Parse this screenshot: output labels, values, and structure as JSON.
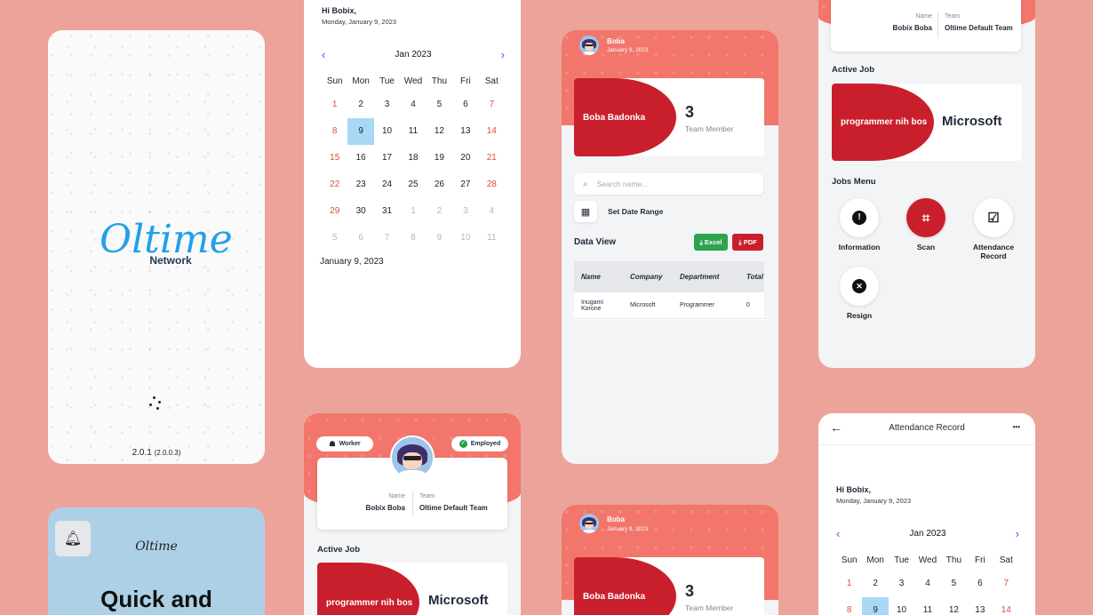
{
  "splash": {
    "brand": "Oltime",
    "sub": "Network",
    "version": "2.0.1",
    "build": "(2.0.0.3)"
  },
  "onboard": {
    "brand": "Oltime",
    "headline": "Quick and"
  },
  "calendar1": {
    "greeting": "Hi Bobix,",
    "date": "Monday, January 9, 2023",
    "month": "Jan 2023",
    "prev": "‹",
    "next": "›",
    "weekdays": [
      "Sun",
      "Mon",
      "Tue",
      "Wed",
      "Thu",
      "Fri",
      "Sat"
    ],
    "days": [
      "1",
      "2",
      "3",
      "4",
      "5",
      "6",
      "7",
      "8",
      "9",
      "10",
      "11",
      "12",
      "13",
      "14",
      "15",
      "16",
      "17",
      "18",
      "19",
      "20",
      "21",
      "22",
      "23",
      "24",
      "25",
      "26",
      "27",
      "28",
      "29",
      "30",
      "31",
      "1",
      "2",
      "3",
      "4",
      "5",
      "6",
      "7",
      "8",
      "9",
      "10",
      "11"
    ],
    "selected_label": "January 9, 2023"
  },
  "profile": {
    "badge_worker": "Worker",
    "badge_status": "Employed",
    "name_label": "Name",
    "name": "Bobix Boba",
    "team_label": "Team",
    "team": "Oltime Default Team",
    "active_job": "Active Job",
    "job_title": "programmer nih bos",
    "company": "Microsoft"
  },
  "team": {
    "user": "Boba",
    "date": "January 9, 2023",
    "leader": "Boba Badonka",
    "count": "3",
    "count_label": "Team Member",
    "search_placeholder": "Search name...",
    "date_range": "Set Date Range",
    "data_view": "Data View",
    "excel": "Excel",
    "pdf": "PDF",
    "headers": [
      "Name",
      "Company",
      "Department",
      "Total"
    ],
    "rows": [
      [
        "Inugami Korone",
        "Microsoft",
        "Programmer",
        "0"
      ]
    ]
  },
  "team2": {
    "user": "Boba",
    "date": "January 9, 2023",
    "leader": "Boba Badonka",
    "count": "3",
    "count_label": "Team Member"
  },
  "jobs": {
    "name_label": "Name",
    "name": "Bobix Boba",
    "team_label": "Team",
    "team": "Oltime Default Team",
    "active_job": "Active Job",
    "job_title": "programmer nih bos",
    "company": "Microsoft",
    "menu_title": "Jobs Menu",
    "menu": [
      "Information",
      "Scan",
      "Attendance Record",
      "Resign"
    ]
  },
  "attendance": {
    "title": "Attendance Record",
    "more": "•••",
    "greeting": "Hi Bobix,",
    "date": "Monday, January 9, 2023",
    "month": "Jan 2023",
    "weekdays": [
      "Sun",
      "Mon",
      "Tue",
      "Wed",
      "Thu",
      "Fri",
      "Sat"
    ],
    "days": [
      "1",
      "2",
      "3",
      "4",
      "5",
      "6",
      "7",
      "8",
      "9",
      "10",
      "11",
      "12",
      "13",
      "14"
    ]
  },
  "colors": {
    "accent": "#c91f2c",
    "header": "#f2766b",
    "background": "#eba39a",
    "select": "#a8d8f5",
    "link": "#2563eb"
  }
}
